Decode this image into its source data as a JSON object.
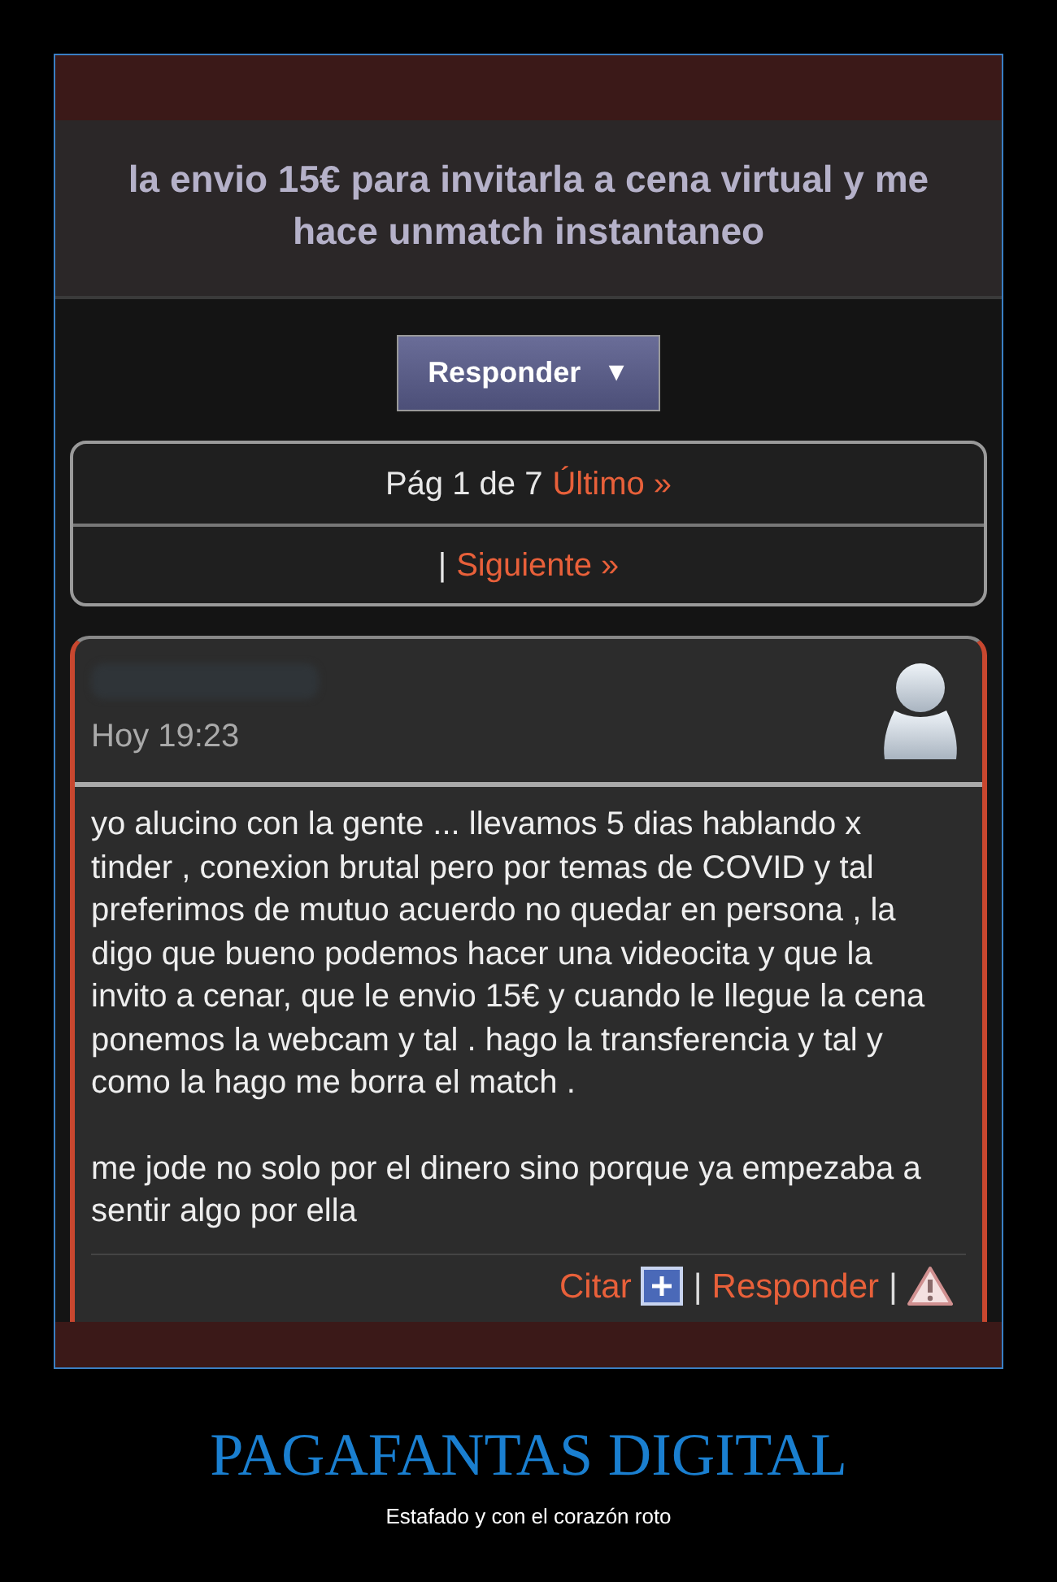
{
  "thread": {
    "title": "la envio 15€ para invitarla a cena virtual y me hace unmatch instantaneo"
  },
  "reply_button": {
    "label": "Responder",
    "caret": "▼"
  },
  "pagination": {
    "page_info": "Pág 1 de 7",
    "last_link": "Último »",
    "separator": "|",
    "next_link": "Siguiente »"
  },
  "post": {
    "time": "Hoy 19:23",
    "paragraphs": [
      "yo alucino con la gente ... llevamos 5 dias hablando x tinder , conexion brutal pero por temas de COVID y tal preferimos de mutuo acuerdo no quedar en persona , la digo que bueno podemos hacer una videocita y que la invito a cenar, que le envio 15€ y cuando le llegue la cena ponemos la webcam y tal . hago la transferencia y tal y como la hago me borra el match .",
      "me jode no solo por el dinero sino porque ya empezaba a sentir algo por ella"
    ],
    "actions": [
      {
        "kind": "link",
        "label": "Citar"
      },
      {
        "kind": "plus"
      },
      {
        "kind": "sep",
        "label": "|"
      },
      {
        "kind": "link",
        "label": "Responder"
      },
      {
        "kind": "sep",
        "label": "|"
      },
      {
        "kind": "warning"
      }
    ]
  },
  "caption": {
    "title": "PAGAFANTAS DIGITAL",
    "subtitle": "Estafado y con el corazón roto"
  }
}
